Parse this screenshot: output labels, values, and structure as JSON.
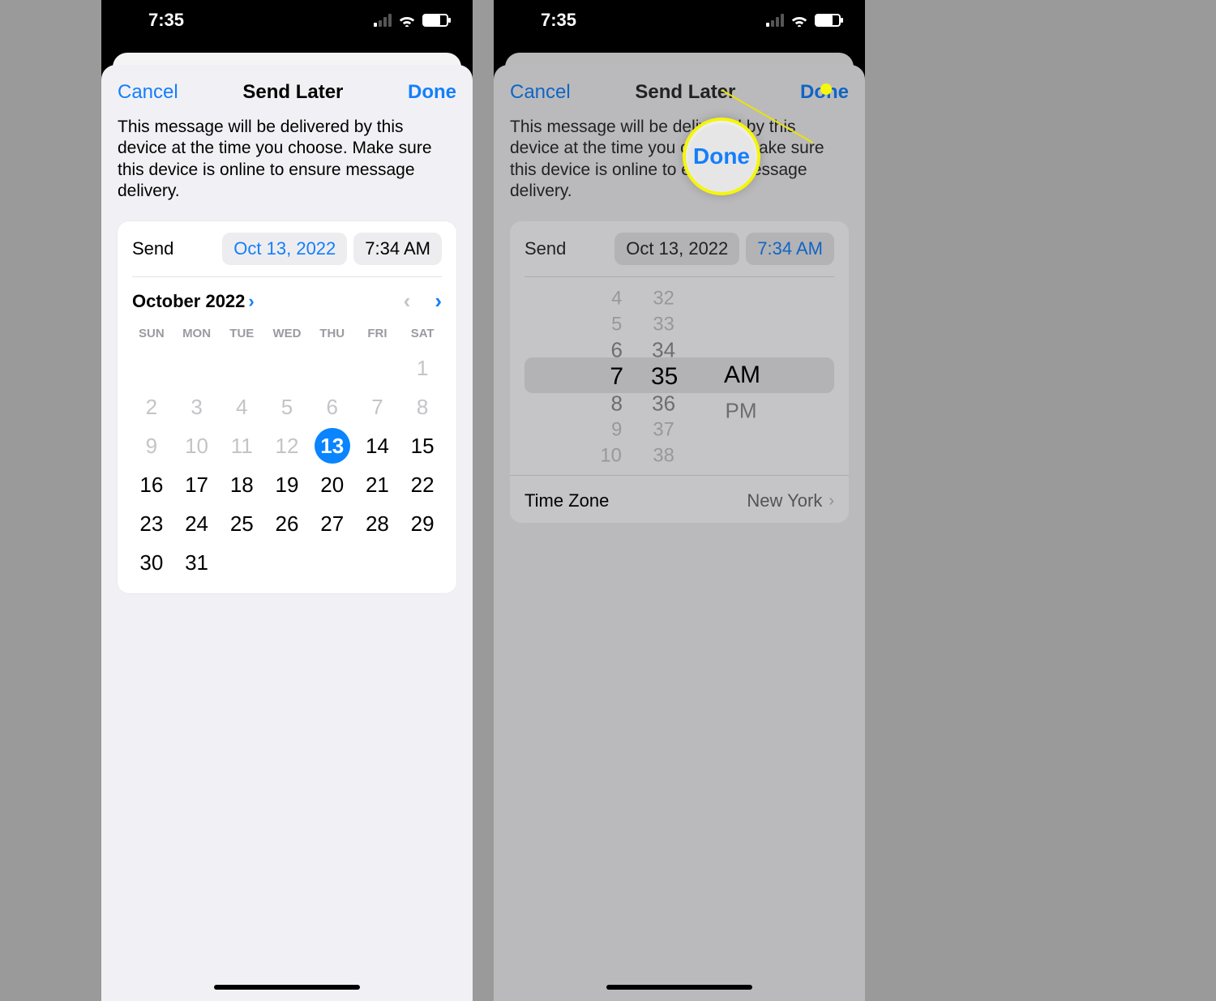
{
  "status": {
    "time": "7:35"
  },
  "modal": {
    "cancel": "Cancel",
    "title": "Send Later",
    "done": "Done",
    "description": "This message will be delivered by this device at the time you choose. Make sure this device is online to ensure message delivery."
  },
  "left": {
    "send_label": "Send",
    "date_pill": "Oct 13, 2022",
    "time_pill": "7:34 AM",
    "calendar": {
      "title": "October 2022",
      "dow": [
        "SUN",
        "MON",
        "TUE",
        "WED",
        "THU",
        "FRI",
        "SAT"
      ],
      "weeks": [
        [
          null,
          null,
          null,
          null,
          null,
          null,
          {
            "n": "1",
            "dis": true
          }
        ],
        [
          {
            "n": "2",
            "dis": true
          },
          {
            "n": "3",
            "dis": true
          },
          {
            "n": "4",
            "dis": true
          },
          {
            "n": "5",
            "dis": true
          },
          {
            "n": "6",
            "dis": true
          },
          {
            "n": "7",
            "dis": true
          },
          {
            "n": "8",
            "dis": true
          }
        ],
        [
          {
            "n": "9",
            "dis": true
          },
          {
            "n": "10",
            "dis": true
          },
          {
            "n": "11",
            "dis": true
          },
          {
            "n": "12",
            "dis": true
          },
          {
            "n": "13",
            "sel": true
          },
          {
            "n": "14"
          },
          {
            "n": "15"
          }
        ],
        [
          {
            "n": "16"
          },
          {
            "n": "17"
          },
          {
            "n": "18"
          },
          {
            "n": "19"
          },
          {
            "n": "20"
          },
          {
            "n": "21"
          },
          {
            "n": "22"
          }
        ],
        [
          {
            "n": "23"
          },
          {
            "n": "24"
          },
          {
            "n": "25"
          },
          {
            "n": "26"
          },
          {
            "n": "27"
          },
          {
            "n": "28"
          },
          {
            "n": "29"
          }
        ],
        [
          {
            "n": "30"
          },
          {
            "n": "31"
          },
          null,
          null,
          null,
          null,
          null
        ]
      ]
    }
  },
  "right": {
    "send_label": "Send",
    "date_pill": "Oct 13, 2022",
    "time_pill": "7:34 AM",
    "wheel": {
      "hours": [
        "4",
        "5",
        "6",
        "7",
        "8",
        "9",
        "10"
      ],
      "mins": [
        "32",
        "33",
        "34",
        "35",
        "36",
        "37",
        "38"
      ],
      "ampm_sel": "AM",
      "ampm_other": "PM"
    },
    "timezone": {
      "label": "Time Zone",
      "value": "New York"
    }
  },
  "callout": {
    "text": "Done"
  }
}
